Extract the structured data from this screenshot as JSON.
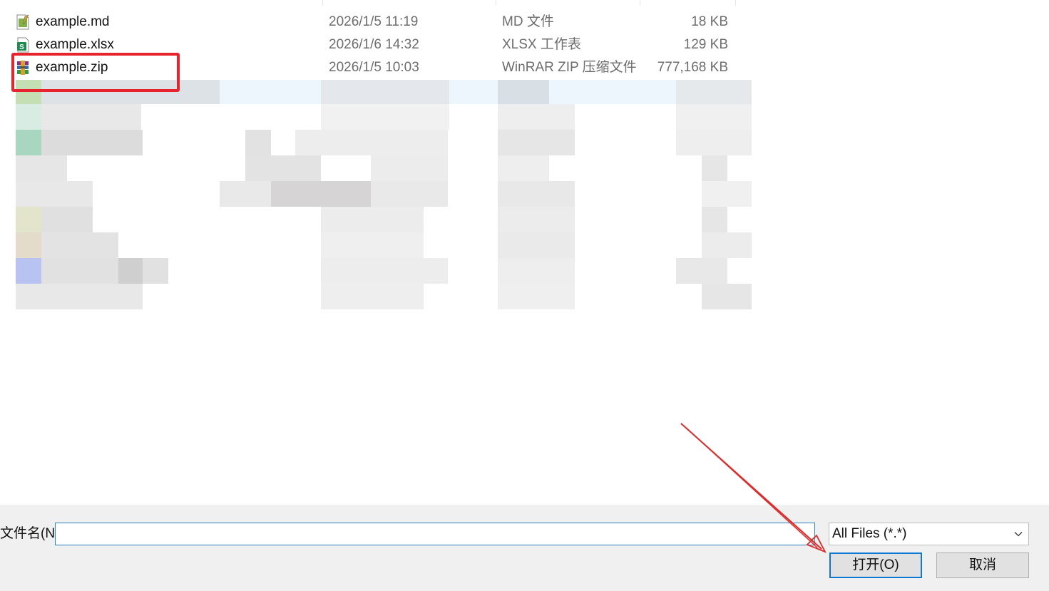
{
  "files": [
    {
      "name": "example.md",
      "date": "2026/1/5 11:19",
      "type": "MD 文件",
      "size": "18 KB",
      "icon": "markdown-file-icon"
    },
    {
      "name": "example.xlsx",
      "date": "2026/1/6 14:32",
      "type": "XLSX 工作表",
      "size": "129 KB",
      "icon": "spreadsheet-file-icon"
    },
    {
      "name": "example.zip",
      "date": "2026/1/5 10:03",
      "type": "WinRAR ZIP 压缩文件",
      "size": "777,168 KB",
      "icon": "winrar-archive-icon"
    }
  ],
  "bottom_bar": {
    "filename_label": "文件名(N):",
    "filename_value": "",
    "file_type_selected": "All Files (*.*)",
    "open_button": "打开(O)",
    "cancel_button": "取消"
  },
  "colors": {
    "highlight": "#e8232e",
    "accent": "#0b78d6",
    "input_border": "#2a82c4"
  }
}
